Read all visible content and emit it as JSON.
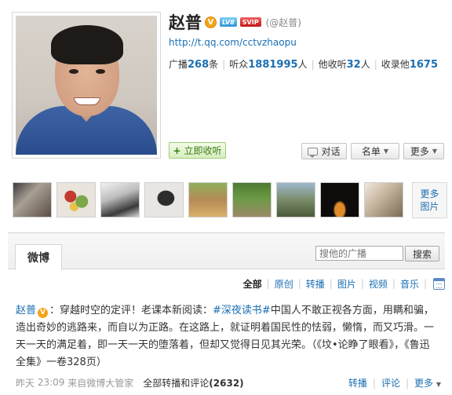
{
  "profile": {
    "name": "赵普",
    "handle": "(@赵普)",
    "level_badge": "LV8",
    "svip_badge": "SVIP",
    "url": "http://t.qq.com/cctvzhaopu",
    "stats": {
      "broadcast_label": "广播",
      "broadcast_count": "268",
      "broadcast_unit": "条",
      "listeners_label": "听众",
      "listeners_count": "1881995",
      "listeners_unit": "人",
      "following_label": "他收听",
      "following_count": "32",
      "following_unit": "人",
      "followedby_label": "收录他",
      "followedby_count": "1675"
    },
    "follow_button": "立即收听",
    "chat_button": "对话",
    "list_button": "名单",
    "more_button": "更多"
  },
  "photos": {
    "more_label_line1": "更多",
    "more_label_line2": "图片"
  },
  "weibo": {
    "tab_label": "微博",
    "search_placeholder": "搜他的广播",
    "search_button": "搜索",
    "filters": [
      "全部",
      "原创",
      "转播",
      "图片",
      "视频",
      "音乐"
    ],
    "post": {
      "author": "赵普",
      "text_1": "：穿越时空的定评！老课本新阅读：",
      "topic": "#深夜读书#",
      "text_2": "中国人不敢正视各方面，用瞒和骗，造出奇妙的逃路来，而自以为正路。在这路上，就证明着国民性的怯弱，懒惰，而又巧滑。一天一天的满足着，即一天一天的堕落着，但却又觉得日见其光荣。（《坟•论睁了眼看》，《鲁迅全集》一卷328页）"
    },
    "meta": {
      "day": "昨天",
      "time": "23:09",
      "source": "来自微博大管家",
      "all_reposts_label": "全部转播和评论",
      "all_reposts_count": "(2632)",
      "repost": "转播",
      "comment": "评论",
      "more": "更多"
    }
  }
}
